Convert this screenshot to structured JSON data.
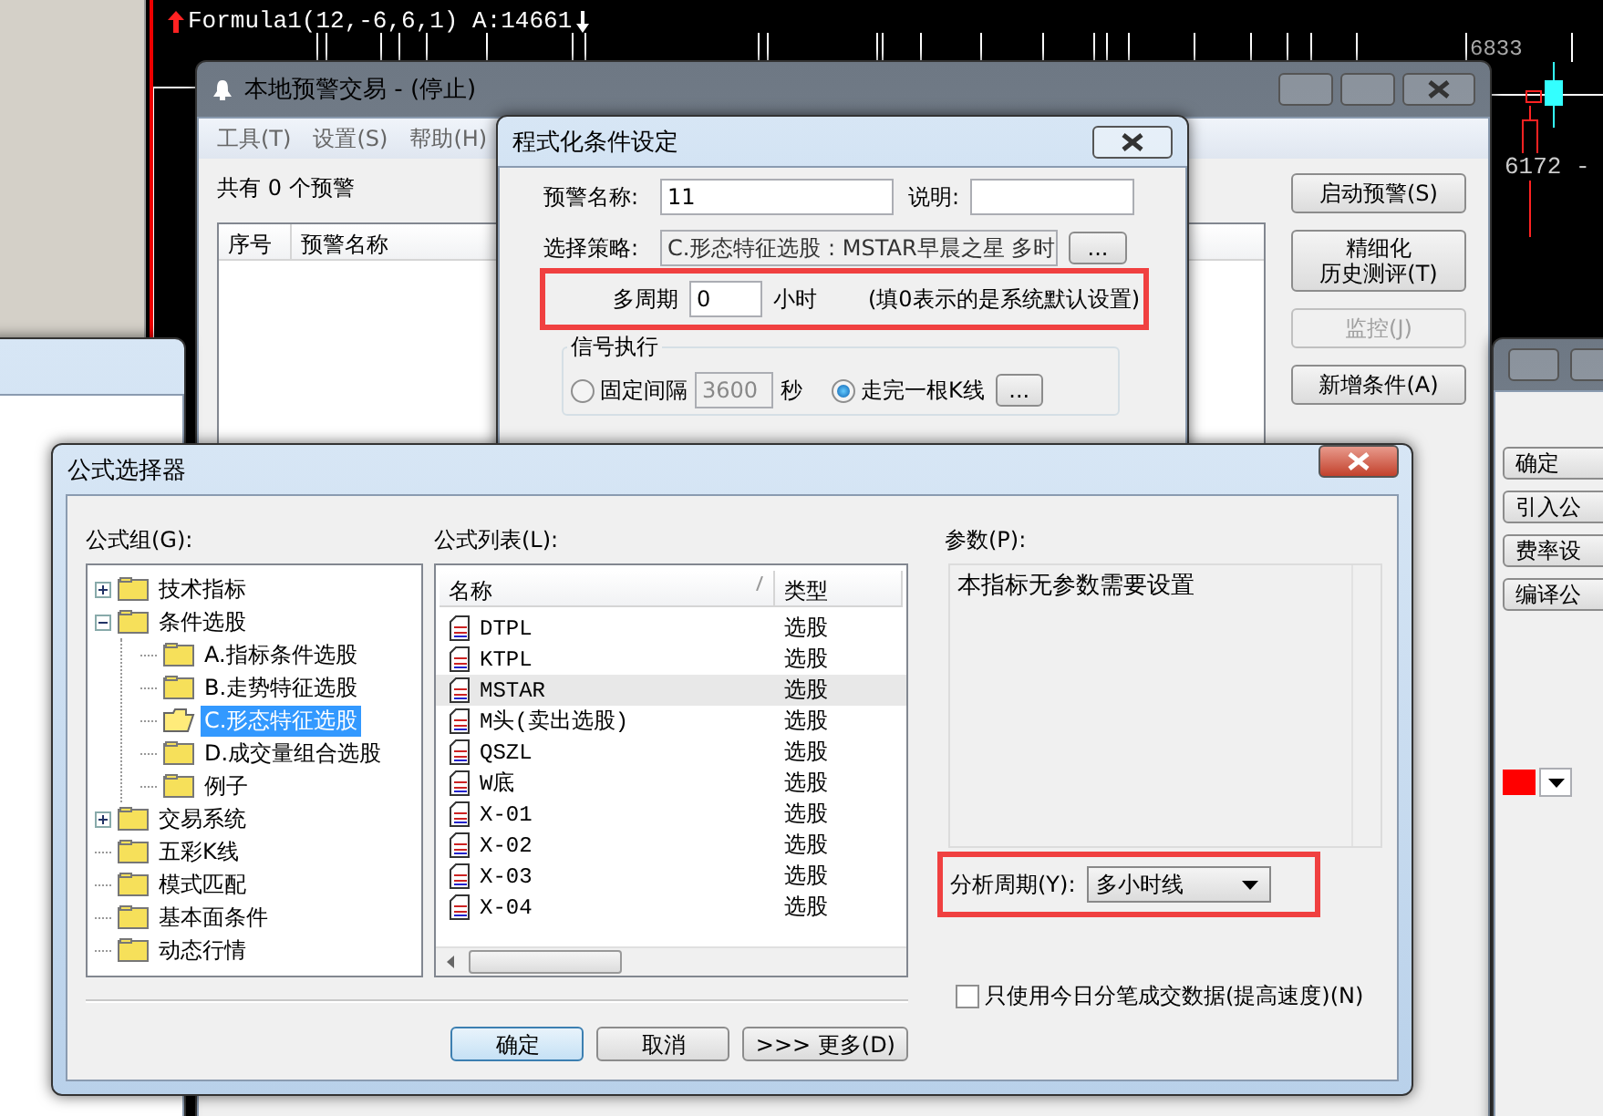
{
  "chart": {
    "formula_label": "Formula1(12,-6,6,1) A:14661",
    "price_high": "6833",
    "price_low": "6172 -"
  },
  "alert_window": {
    "title": "本地预警交易 - (停止)",
    "menu": [
      "工具(T)",
      "设置(S)",
      "帮助(H)"
    ],
    "summary": "共有 0 个预警",
    "columns": [
      "序号",
      "预警名称"
    ],
    "buttons": [
      {
        "label": "启动预警(S)",
        "disabled": false
      },
      {
        "lines": [
          "精细化",
          "历史测评(T)"
        ],
        "disabled": false
      },
      {
        "label": "监控(J)",
        "disabled": true
      },
      {
        "label": "新增条件(A)",
        "disabled": false
      }
    ]
  },
  "condition_dialog": {
    "title": "程式化条件设定",
    "name_label": "预警名称:",
    "name": "11",
    "note_label": "说明:",
    "strategy_label": "选择策略:",
    "strategy": "C.形态特征选股 : MSTAR早晨之星 多时",
    "browse_button": "...",
    "period_label": "多周期",
    "period": "0",
    "period_unit": "小时",
    "period_hint": "(填0表示的是系统默认设置)",
    "signal_group": "信号执行",
    "signal_options": [
      {
        "label": "固定间隔",
        "selected": false
      },
      {
        "label": "走完一根K线",
        "selected": true
      }
    ],
    "interval": "3600",
    "interval_unit": "秒",
    "option_button": "..."
  },
  "side_window": {
    "buttons": [
      "确定",
      "引入公",
      "费率设",
      "编译公"
    ]
  },
  "formula_dialog": {
    "title": "公式选择器",
    "group_label": "公式组(G):",
    "groups": [
      {
        "label": "技术指标",
        "expanded": false,
        "selected": false
      },
      {
        "label": "条件选股",
        "expanded": true,
        "selected": false,
        "children": [
          {
            "label": "A.指标条件选股",
            "selected": false
          },
          {
            "label": "B.走势特征选股",
            "selected": false
          },
          {
            "label": "C.形态特征选股",
            "selected": true
          },
          {
            "label": "D.成交量组合选股",
            "selected": false
          },
          {
            "label": "例子",
            "selected": false
          }
        ]
      },
      {
        "label": "交易系统",
        "expanded": false,
        "selected": false
      },
      {
        "label": "五彩K线",
        "selected": false
      },
      {
        "label": "模式匹配",
        "selected": false
      },
      {
        "label": "基本面条件",
        "selected": false
      },
      {
        "label": "动态行情",
        "selected": false
      }
    ],
    "list_label": "公式列表(L):",
    "columns": [
      "名称",
      "类型"
    ],
    "rows": [
      {
        "name": "DTPL",
        "type": "选股",
        "selected": false
      },
      {
        "name": "KTPL",
        "type": "选股",
        "selected": false
      },
      {
        "name": "MSTAR",
        "type": "选股",
        "selected": true
      },
      {
        "name": "M头(卖出选股)",
        "type": "选股",
        "selected": false
      },
      {
        "name": "QSZL",
        "type": "选股",
        "selected": false
      },
      {
        "name": "W底",
        "type": "选股",
        "selected": false
      },
      {
        "name": "X-01",
        "type": "选股",
        "selected": false
      },
      {
        "name": "X-02",
        "type": "选股",
        "selected": false
      },
      {
        "name": "X-03",
        "type": "选股",
        "selected": false
      },
      {
        "name": "X-04",
        "type": "选股",
        "selected": false
      }
    ],
    "params_label": "参数(P):",
    "params_text": "本指标无参数需要设置",
    "period_label": "分析周期(Y):",
    "period": "多小时线",
    "tick_only": {
      "label": "只使用今日分笔成交数据(提高速度)(N)",
      "checked": false
    },
    "buttons": [
      {
        "label": "确定",
        "default": true
      },
      {
        "label": "取消",
        "default": false
      },
      {
        "label": ">>> 更多(D)",
        "default": false
      }
    ]
  }
}
